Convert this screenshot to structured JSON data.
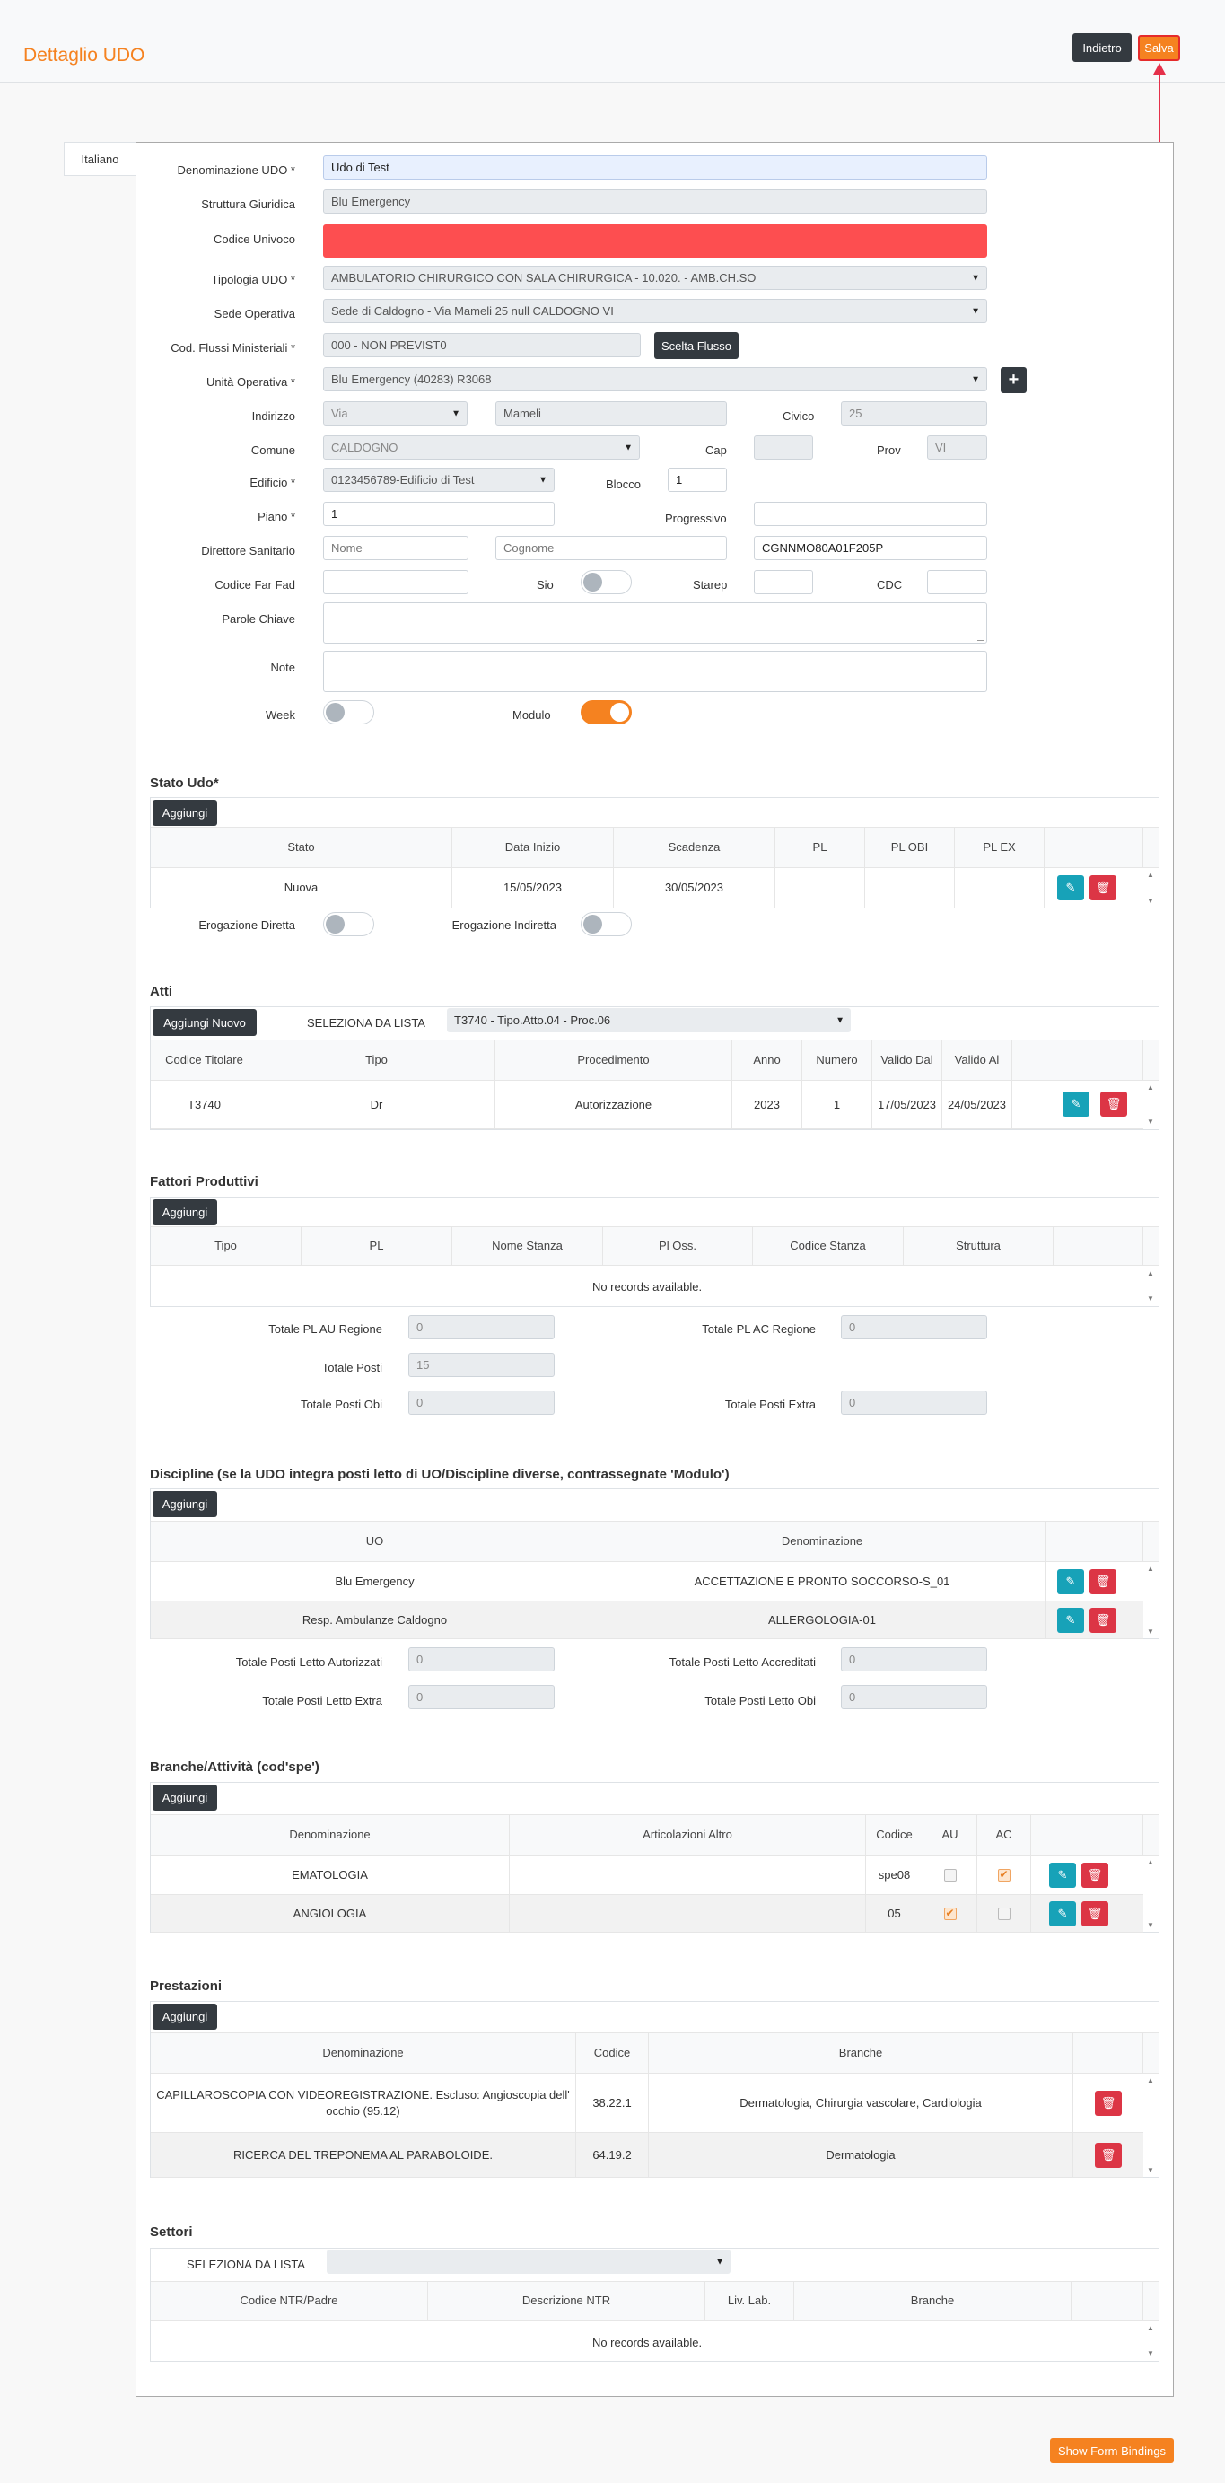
{
  "header": {
    "title": "Dettaglio UDO",
    "back_label": "Indietro",
    "save_label": "Salva"
  },
  "tab": {
    "label": "Italiano"
  },
  "form": {
    "denominazione": {
      "label": "Denominazione UDO *",
      "value": "Udo di Test"
    },
    "struttura": {
      "label": "Struttura Giuridica",
      "value": "Blu Emergency"
    },
    "codice_univoco": {
      "label": "Codice Univoco",
      "value": ""
    },
    "tipologia": {
      "label": "Tipologia UDO *",
      "value": "AMBULATORIO CHIRURGICO CON SALA CHIRURGICA - 10.020. - AMB.CH.SO"
    },
    "sede": {
      "label": "Sede Operativa",
      "value": "Sede di Caldogno - Via Mameli 25 null CALDOGNO VI"
    },
    "flussi": {
      "label": "Cod. Flussi Ministeriali *",
      "value": "000 - NON PREVIST0",
      "button": "Scelta Flusso"
    },
    "unita": {
      "label": "Unità Operativa *",
      "value": "Blu Emergency (40283) R3068",
      "plus": "+"
    },
    "indirizzo": {
      "label": "Indirizzo",
      "via": "Via",
      "strada": "Mameli",
      "civico_label": "Civico",
      "civico": "25"
    },
    "comune": {
      "label": "Comune",
      "value": "CALDOGNO",
      "cap_label": "Cap",
      "cap": "",
      "prov_label": "Prov",
      "prov": "VI"
    },
    "edificio": {
      "label": "Edificio *",
      "value": "0123456789-Edificio di Test",
      "blocco_label": "Blocco",
      "blocco": "1"
    },
    "piano": {
      "label": "Piano *",
      "value": "1",
      "progressivo_label": "Progressivo",
      "progressivo": ""
    },
    "direttore": {
      "label": "Direttore Sanitario",
      "nome": "Nome",
      "cognome": "Cognome",
      "cf": "CGNNMO80A01F205P"
    },
    "farfad": {
      "label": "Codice Far Fad",
      "value": "",
      "sio_label": "Sio",
      "starep_label": "Starep",
      "starep": "",
      "cdc_label": "CDC",
      "cdc": ""
    },
    "parole": {
      "label": "Parole Chiave"
    },
    "note": {
      "label": "Note"
    },
    "week": {
      "label": "Week",
      "on": false
    },
    "modulo": {
      "label": "Modulo",
      "on": true
    }
  },
  "stato": {
    "title": "Stato Udo*",
    "add": "Aggiungi",
    "headers": [
      "Stato",
      "Data Inizio",
      "Scadenza",
      "PL",
      "PL OBI",
      "PL EX"
    ],
    "rows": [
      [
        "Nuova",
        "15/05/2023",
        "30/05/2023",
        "",
        "",
        ""
      ]
    ],
    "erog_diretta": "Erogazione Diretta",
    "erog_indiretta": "Erogazione Indiretta"
  },
  "atti": {
    "title": "Atti",
    "add": "Aggiungi Nuovo",
    "select_label": "SELEZIONA DA LISTA",
    "select_value": "T3740 - Tipo.Atto.04 - Proc.06",
    "headers": [
      "Codice Titolare",
      "Tipo",
      "Procedimento",
      "Anno",
      "Numero",
      "Valido Dal",
      "Valido Al"
    ],
    "rows": [
      [
        "T3740",
        "Dr",
        "Autorizzazione",
        "2023",
        "1",
        "17/05/2023",
        "24/05/2023"
      ]
    ]
  },
  "fattori": {
    "title": "Fattori Produttivi",
    "add": "Aggiungi",
    "headers": [
      "Tipo",
      "PL",
      "Nome Stanza",
      "Pl Oss.",
      "Codice Stanza",
      "Struttura"
    ],
    "empty": "No records available.",
    "totals": {
      "au_label": "Totale PL AU Regione",
      "au": "0",
      "ac_label": "Totale PL AC Regione",
      "ac": "0",
      "posti_label": "Totale Posti",
      "posti": "15",
      "obi_label": "Totale Posti Obi",
      "obi": "0",
      "extra_label": "Totale Posti Extra",
      "extra": "0"
    }
  },
  "discipline": {
    "title": "Discipline (se la UDO integra posti letto di UO/Discipline diverse, contrassegnate 'Modulo')",
    "add": "Aggiungi",
    "headers": [
      "UO",
      "Denominazione"
    ],
    "rows": [
      [
        "Blu Emergency",
        "ACCETTAZIONE E PRONTO SOCCORSO-S_01"
      ],
      [
        "Resp. Ambulanze Caldogno",
        "ALLERGOLOGIA-01"
      ]
    ],
    "totals": {
      "aut_label": "Totale Posti Letto Autorizzati",
      "aut": "0",
      "acc_label": "Totale Posti Letto Accreditati",
      "acc": "0",
      "extra_label": "Totale Posti Letto Extra",
      "extra": "0",
      "obi_label": "Totale Posti Letto Obi",
      "obi": "0"
    }
  },
  "branche": {
    "title": "Branche/Attività (cod'spe')",
    "add": "Aggiungi",
    "headers": [
      "Denominazione",
      "Articolazioni Altro",
      "Codice",
      "AU",
      "AC"
    ],
    "rows": [
      {
        "den": "EMATOLOGIA",
        "altro": "",
        "codice": "spe08",
        "au": false,
        "ac": true
      },
      {
        "den": "ANGIOLOGIA",
        "altro": "",
        "codice": "05",
        "au": true,
        "ac": false
      }
    ]
  },
  "prestazioni": {
    "title": "Prestazioni",
    "add": "Aggiungi",
    "headers": [
      "Denominazione",
      "Codice",
      "Branche"
    ],
    "rows": [
      [
        "CAPILLAROSCOPIA CON VIDEOREGISTRAZIONE. Escluso: Angioscopia dell' occhio (95.12)",
        "38.22.1",
        "Dermatologia, Chirurgia vascolare, Cardiologia"
      ],
      [
        "RICERCA DEL TREPONEMA AL PARABOLOIDE.",
        "64.19.2",
        "Dermatologia"
      ]
    ]
  },
  "settori": {
    "title": "Settori",
    "select_label": "SELEZIONA DA LISTA",
    "headers": [
      "Codice NTR/Padre",
      "Descrizione NTR",
      "Liv. Lab.",
      "Branche"
    ],
    "empty": "No records available."
  },
  "footer": {
    "bindings_label": "Show Form Bindings"
  },
  "colors": {
    "accent": "#f58220",
    "dark": "#343a40",
    "edit": "#17a2b8",
    "delete": "#dc3545",
    "error": "#fd4e50"
  }
}
